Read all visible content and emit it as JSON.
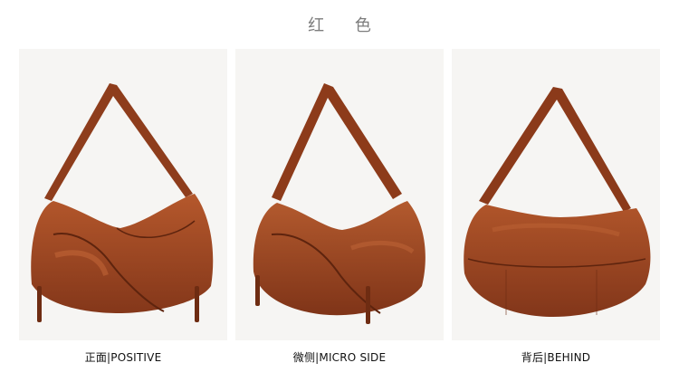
{
  "header": {
    "title": "红 色"
  },
  "views": [
    {
      "caption": "正面|POSITIVE"
    },
    {
      "caption": "微侧|MICRO SIDE"
    },
    {
      "caption": "背后|BEHIND"
    }
  ],
  "colors": {
    "leather": "#9a4420",
    "leather_dark": "#6e2c12",
    "leather_light": "#b5582c",
    "panel_bg": "#f6f5f3",
    "title_text": "#7d7d7d"
  }
}
